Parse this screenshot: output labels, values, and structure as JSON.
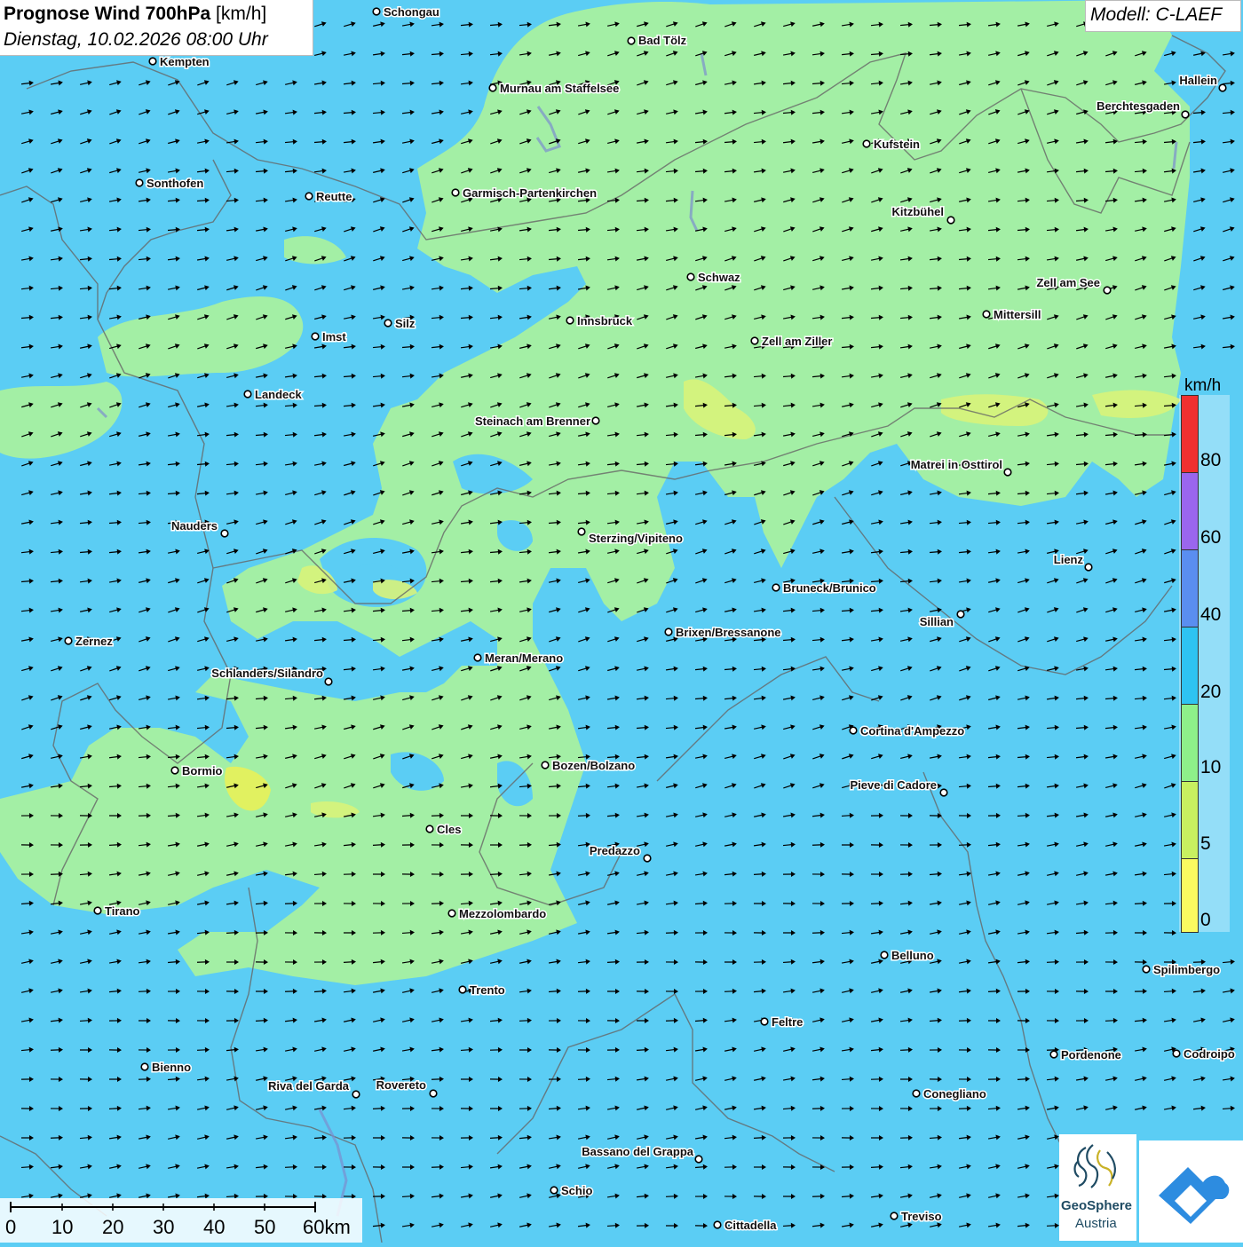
{
  "title": {
    "bold": "Prognose Wind 700hPa",
    "unit": "[km/h]",
    "datetime": "Dienstag, 10.02.2026 08:00 Uhr"
  },
  "model": "Modell: C-LAEF",
  "legend": {
    "unit": "km/h",
    "ticks": [
      "80",
      "60",
      "40",
      "20",
      "10",
      "5",
      "0"
    ],
    "colors": [
      "#f03030",
      "#9a66ee",
      "#5a8ef0",
      "#2ec3f2",
      "#8ef08a",
      "#c8f060",
      "#fafa60"
    ]
  },
  "scale": {
    "labels": [
      "0",
      "10",
      "20",
      "30",
      "40",
      "50",
      "60km"
    ]
  },
  "logo": {
    "line1": "GeoSphere",
    "line2": "Austria"
  },
  "cities": [
    {
      "name": "Schongau"
    },
    {
      "name": "Bad Tölz"
    },
    {
      "name": "Kempten"
    },
    {
      "name": "Murnau am Staffelsee"
    },
    {
      "name": "Hallein"
    },
    {
      "name": "Berchtesgaden"
    },
    {
      "name": "Kufstein"
    },
    {
      "name": "Sonthofen"
    },
    {
      "name": "Reutte"
    },
    {
      "name": "Garmisch-Partenkirchen"
    },
    {
      "name": "Kitzbühel"
    },
    {
      "name": "Schwaz"
    },
    {
      "name": "Zell am See"
    },
    {
      "name": "Mittersill"
    },
    {
      "name": "Silz"
    },
    {
      "name": "Imst"
    },
    {
      "name": "Innsbruck"
    },
    {
      "name": "Zell am Ziller"
    },
    {
      "name": "Landeck"
    },
    {
      "name": "Steinach am Brenner"
    },
    {
      "name": "Matrei in Osttirol"
    },
    {
      "name": "Nauders"
    },
    {
      "name": "Sterzing/Vipiteno"
    },
    {
      "name": "Lienz"
    },
    {
      "name": "Bruneck/Brunico"
    },
    {
      "name": "Sillian"
    },
    {
      "name": "Brixen/Bressanone"
    },
    {
      "name": "Zernez"
    },
    {
      "name": "Meran/Merano"
    },
    {
      "name": "Schlanders/Silandro"
    },
    {
      "name": "Cortina d'Ampezzo"
    },
    {
      "name": "Bozen/Bolzano"
    },
    {
      "name": "Bormio"
    },
    {
      "name": "Pieve di Cadore"
    },
    {
      "name": "Cles"
    },
    {
      "name": "Predazzo"
    },
    {
      "name": "Tirano"
    },
    {
      "name": "Mezzolombardo"
    },
    {
      "name": "Belluno"
    },
    {
      "name": "Spilimbergo"
    },
    {
      "name": "Trento"
    },
    {
      "name": "Feltre"
    },
    {
      "name": "Pordenone"
    },
    {
      "name": "Codroipo"
    },
    {
      "name": "Bienno"
    },
    {
      "name": "Riva del Garda"
    },
    {
      "name": "Rovereto"
    },
    {
      "name": "Conegliano"
    },
    {
      "name": "Bassano del Grappa"
    },
    {
      "name": "Schio"
    },
    {
      "name": "Treviso"
    },
    {
      "name": "Cittadella"
    }
  ]
}
